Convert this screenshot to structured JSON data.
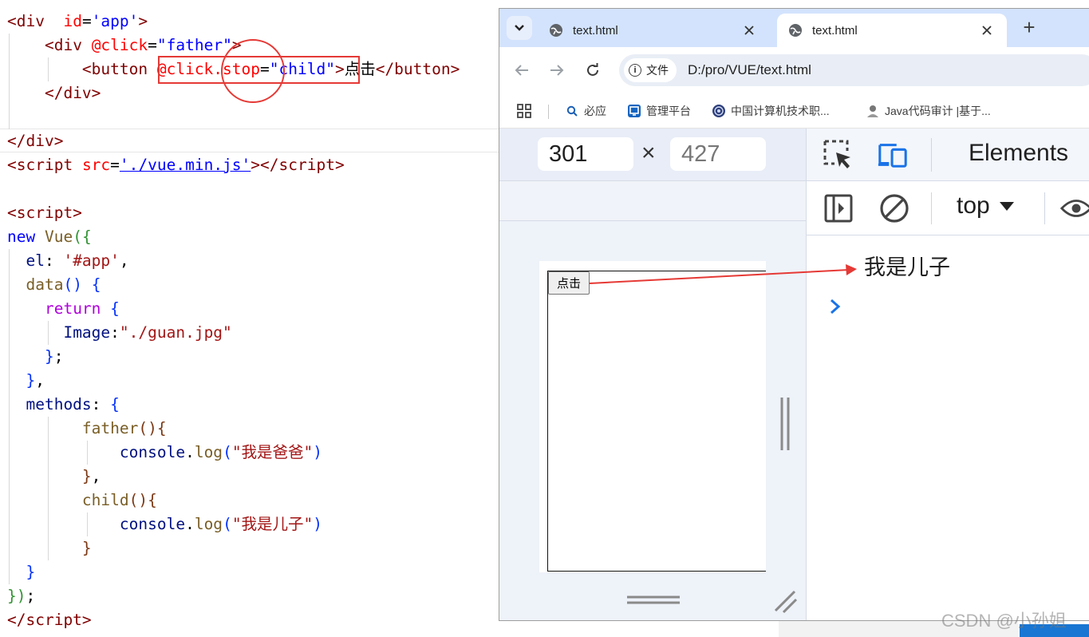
{
  "editor": {
    "lines": [
      {
        "parts": [
          [
            "t-tag",
            "<div"
          ],
          [
            "t-pl",
            "  "
          ],
          [
            "t-attr",
            "id"
          ],
          [
            "t-pl",
            "="
          ],
          [
            "t-str",
            "'app'"
          ],
          [
            "t-tag",
            ">"
          ]
        ]
      },
      {
        "parts": [
          [
            "t-pl",
            "    "
          ],
          [
            "t-tag",
            "<div"
          ],
          [
            "t-pl",
            " "
          ],
          [
            "t-attr",
            "@click"
          ],
          [
            "t-pl",
            "="
          ],
          [
            "t-str",
            "\"father\""
          ],
          [
            "t-tag",
            ">"
          ]
        ]
      },
      {
        "parts": [
          [
            "t-pl",
            "        "
          ],
          [
            "t-tag",
            "<button"
          ],
          [
            "t-pl",
            " "
          ],
          [
            "t-attr",
            "@click.stop"
          ],
          [
            "t-pl",
            "="
          ],
          [
            "t-str",
            "\"child\""
          ],
          [
            "t-tag",
            ">"
          ],
          [
            "t-txt",
            "点击"
          ],
          [
            "t-tag",
            "</button>"
          ]
        ]
      },
      {
        "parts": [
          [
            "t-pl",
            "    "
          ],
          [
            "t-tag",
            "</div>"
          ]
        ]
      },
      {
        "parts": []
      },
      {
        "parts": [
          [
            "t-tag",
            "</div>"
          ]
        ]
      },
      {
        "parts": [
          [
            "t-tag",
            "<script"
          ],
          [
            "t-pl",
            " "
          ],
          [
            "t-attr",
            "src"
          ],
          [
            "t-pl",
            "="
          ],
          [
            "t-link",
            "'./vue.min.js'"
          ],
          [
            "t-tag",
            "></"
          ],
          [
            "t-tag",
            "script>"
          ]
        ]
      },
      {
        "parts": []
      },
      {
        "parts": [
          [
            "t-tag",
            "<script>"
          ]
        ]
      },
      {
        "parts": [
          [
            "t-js",
            "new"
          ],
          [
            "t-pl",
            " "
          ],
          [
            "t-fn",
            "Vue"
          ],
          [
            "t-br2",
            "({"
          ]
        ]
      },
      {
        "parts": [
          [
            "t-pl",
            "  "
          ],
          [
            "t-prop",
            "el"
          ],
          [
            "t-pl",
            ": "
          ],
          [
            "t-jstr",
            "'#app'"
          ],
          [
            "t-pl",
            ","
          ]
        ]
      },
      {
        "parts": [
          [
            "t-pl",
            "  "
          ],
          [
            "t-fn",
            "data"
          ],
          [
            "t-br1",
            "()"
          ],
          [
            "t-pl",
            " "
          ],
          [
            "t-br1",
            "{"
          ]
        ]
      },
      {
        "parts": [
          [
            "t-pl",
            "    "
          ],
          [
            "t-key",
            "return"
          ],
          [
            "t-pl",
            " "
          ],
          [
            "t-br1",
            "{"
          ]
        ]
      },
      {
        "parts": [
          [
            "t-pl",
            "      "
          ],
          [
            "t-prop",
            "Image"
          ],
          [
            "t-pl",
            ":"
          ],
          [
            "t-jstr",
            "\"./guan.jpg\""
          ]
        ]
      },
      {
        "parts": [
          [
            "t-pl",
            "    "
          ],
          [
            "t-br1",
            "}"
          ],
          [
            "t-pl",
            ";"
          ]
        ]
      },
      {
        "parts": [
          [
            "t-pl",
            "  "
          ],
          [
            "t-br1",
            "}"
          ],
          [
            "t-pl",
            ","
          ]
        ]
      },
      {
        "parts": [
          [
            "t-pl",
            "  "
          ],
          [
            "t-prop",
            "methods"
          ],
          [
            "t-pl",
            ": "
          ],
          [
            "t-br1",
            "{"
          ]
        ]
      },
      {
        "parts": [
          [
            "t-pl",
            "        "
          ],
          [
            "t-fn",
            "father"
          ],
          [
            "t-br3",
            "()"
          ],
          [
            "t-br3",
            "{"
          ]
        ]
      },
      {
        "parts": [
          [
            "t-pl",
            "            "
          ],
          [
            "t-prop",
            "console"
          ],
          [
            "t-pl",
            "."
          ],
          [
            "t-fn",
            "log"
          ],
          [
            "t-br1",
            "("
          ],
          [
            "t-jstr",
            "\"我是爸爸\""
          ],
          [
            "t-br1",
            ")"
          ]
        ]
      },
      {
        "parts": [
          [
            "t-pl",
            "        "
          ],
          [
            "t-br3",
            "}"
          ],
          [
            "t-pl",
            ","
          ]
        ]
      },
      {
        "parts": [
          [
            "t-pl",
            "        "
          ],
          [
            "t-fn",
            "child"
          ],
          [
            "t-br3",
            "()"
          ],
          [
            "t-br3",
            "{"
          ]
        ]
      },
      {
        "parts": [
          [
            "t-pl",
            "            "
          ],
          [
            "t-prop",
            "console"
          ],
          [
            "t-pl",
            "."
          ],
          [
            "t-fn",
            "log"
          ],
          [
            "t-br1",
            "("
          ],
          [
            "t-jstr",
            "\"我是儿子\""
          ],
          [
            "t-br1",
            ")"
          ]
        ]
      },
      {
        "parts": [
          [
            "t-pl",
            "        "
          ],
          [
            "t-br3",
            "}"
          ]
        ]
      },
      {
        "parts": [
          [
            "t-pl",
            "  "
          ],
          [
            "t-br1",
            "}"
          ]
        ]
      },
      {
        "parts": [
          [
            "t-br2",
            "})"
          ],
          [
            "t-pl",
            ";"
          ]
        ]
      },
      {
        "parts": [
          [
            "t-tag",
            "</"
          ],
          [
            "t-tag",
            "script>"
          ]
        ]
      }
    ]
  },
  "browser": {
    "tabs": [
      {
        "title": "text.html",
        "active": false
      },
      {
        "title": "text.html",
        "active": true
      }
    ],
    "new_tab_label": "+",
    "address": {
      "chip_label": "文件",
      "url": "D:/pro/VUE/text.html"
    },
    "bookmarks": [
      {
        "label": "必应",
        "icon": "search-icon"
      },
      {
        "label": "管理平台",
        "icon": "admin-icon"
      },
      {
        "label": "中国计算机技术职...",
        "icon": "globe-seal-icon"
      },
      {
        "label": "Java代码审计 |基于...",
        "icon": "person-icon"
      }
    ],
    "device": {
      "width": "301",
      "height": "427",
      "times": "×"
    },
    "page": {
      "button_label": "点击"
    },
    "devtools": {
      "panel_label": "Elements",
      "context_label": "top",
      "console_message": "我是儿子"
    }
  },
  "watermark": "CSDN @小孙姐",
  "colors": {
    "annotation": "#e53935",
    "tabstrip": "#d3e3fd",
    "devtools_accent": "#1a73e8"
  }
}
